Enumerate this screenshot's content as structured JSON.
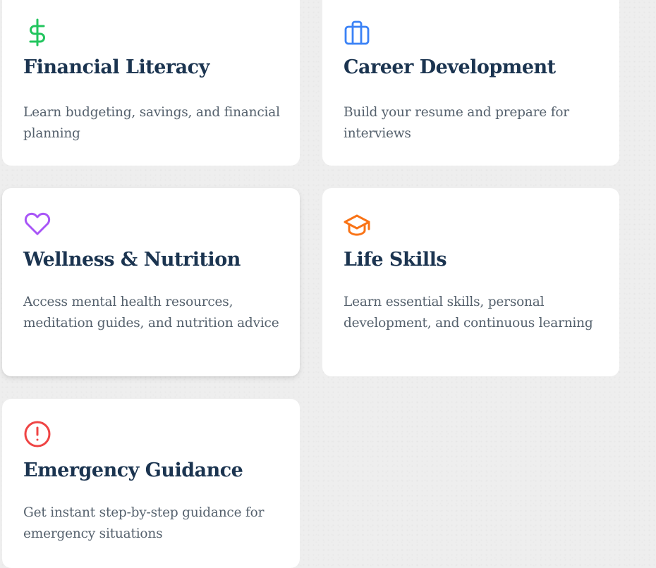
{
  "cards": [
    {
      "title": "Financial Literacy",
      "description": "Learn budgeting, savings, and financial planning",
      "icon": "dollar-icon",
      "icon_color": "#22c55e"
    },
    {
      "title": "Career Development",
      "description": "Build your resume and prepare for interviews",
      "icon": "briefcase-icon",
      "icon_color": "#3b82f6"
    },
    {
      "title": "Wellness & Nutrition",
      "description": "Access mental health resources, meditation guides, and nutrition advice",
      "icon": "heart-icon",
      "icon_color": "#a855f7"
    },
    {
      "title": "Life Skills",
      "description": "Learn essential skills, personal development, and continuous learning",
      "icon": "graduation-cap-icon",
      "icon_color": "#f97316"
    },
    {
      "title": "Emergency Guidance",
      "description": "Get instant step-by-step guidance for emergency situations",
      "icon": "alert-circle-icon",
      "icon_color": "#ef4444"
    }
  ],
  "colors": {
    "title": "#1b3450",
    "text": "#55616d",
    "card_bg": "#ffffff",
    "page_bg": "#eeeeee"
  }
}
